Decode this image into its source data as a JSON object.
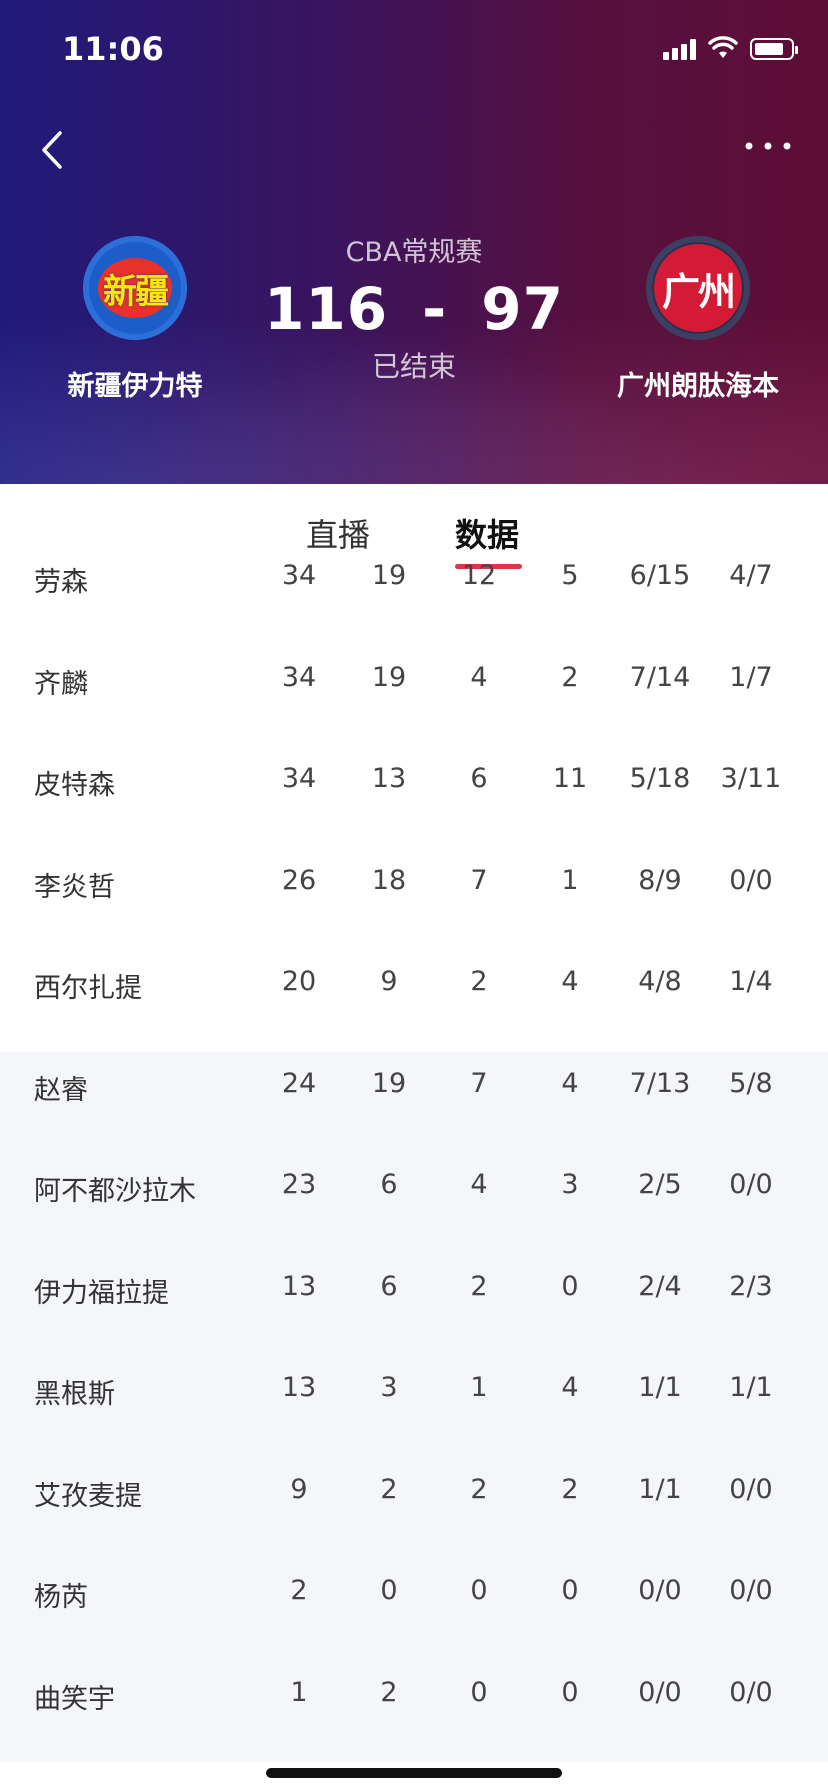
{
  "status_bar": {
    "time": "11:06"
  },
  "match": {
    "league": "CBA常规赛",
    "home_team": {
      "name": "新疆伊力特",
      "logo_text": "新疆",
      "score": "116"
    },
    "away_team": {
      "name": "广州朗肽海本",
      "logo_text": "广州",
      "score": "97"
    },
    "separator": "-",
    "status": "已结束"
  },
  "tabs": [
    {
      "label": "直播",
      "active": false
    },
    {
      "label": "数据",
      "active": true
    }
  ],
  "colors": {
    "accent": "#e0344a",
    "header_left": "#1f1a7a",
    "header_right": "#5e0e36"
  },
  "stats": {
    "starters": [
      {
        "name": "劳森",
        "values": [
          "34",
          "19",
          "12",
          "5",
          "6/15",
          "4/7"
        ]
      },
      {
        "name": "齐麟",
        "values": [
          "34",
          "19",
          "4",
          "2",
          "7/14",
          "1/7"
        ]
      },
      {
        "name": "皮特森",
        "values": [
          "34",
          "13",
          "6",
          "11",
          "5/18",
          "3/11"
        ]
      },
      {
        "name": "李炎哲",
        "values": [
          "26",
          "18",
          "7",
          "1",
          "8/9",
          "0/0"
        ]
      },
      {
        "name": "西尔扎提",
        "values": [
          "20",
          "9",
          "2",
          "4",
          "4/8",
          "1/4"
        ]
      }
    ],
    "bench": [
      {
        "name": "赵睿",
        "values": [
          "24",
          "19",
          "7",
          "4",
          "7/13",
          "5/8"
        ]
      },
      {
        "name": "阿不都沙拉木",
        "values": [
          "23",
          "6",
          "4",
          "3",
          "2/5",
          "0/0"
        ]
      },
      {
        "name": "伊力福拉提",
        "values": [
          "13",
          "6",
          "2",
          "0",
          "2/4",
          "2/3"
        ]
      },
      {
        "name": "黑根斯",
        "values": [
          "13",
          "3",
          "1",
          "4",
          "1/1",
          "1/1"
        ]
      },
      {
        "name": "艾孜麦提",
        "values": [
          "9",
          "2",
          "2",
          "2",
          "1/1",
          "0/0"
        ]
      },
      {
        "name": "杨芮",
        "values": [
          "2",
          "0",
          "0",
          "0",
          "0/0",
          "0/0"
        ]
      },
      {
        "name": "曲笑宇",
        "values": [
          "1",
          "2",
          "0",
          "0",
          "0/0",
          "0/0"
        ]
      }
    ]
  }
}
